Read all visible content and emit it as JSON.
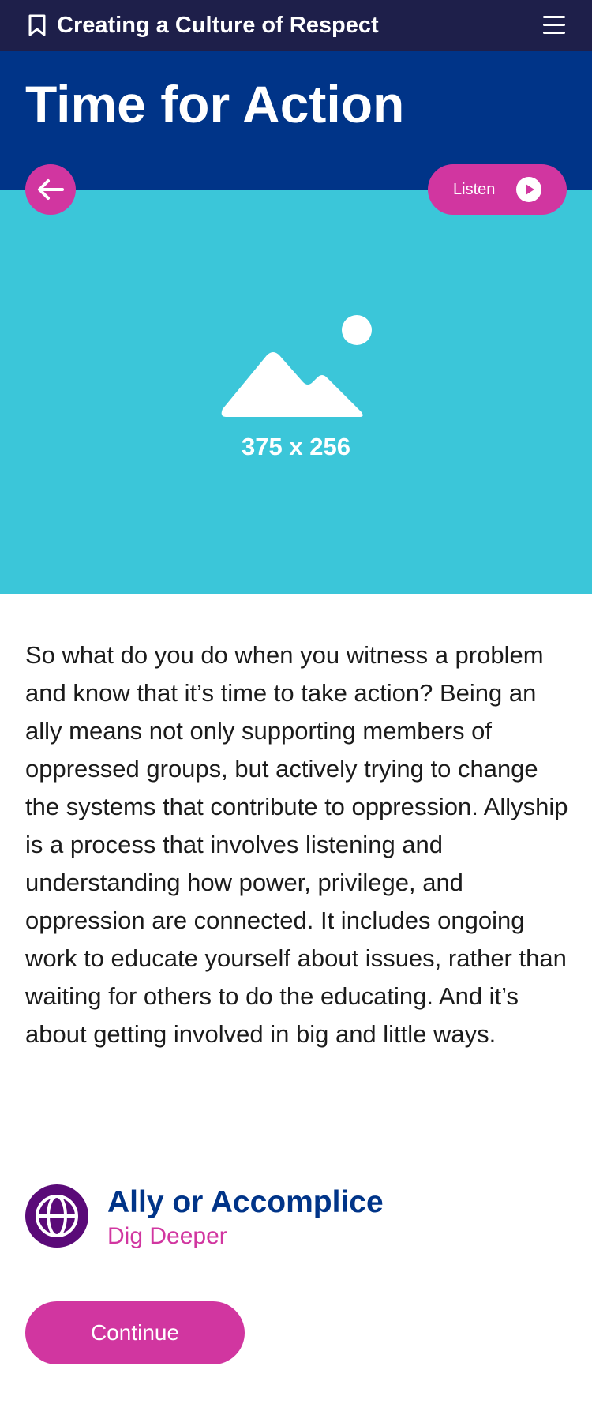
{
  "topbar": {
    "course_title": "Creating a Culture of Respect",
    "bookmark_icon": "bookmark-icon",
    "menu_icon": "hamburger-menu-icon"
  },
  "header": {
    "title": "Time for Action"
  },
  "hero": {
    "placeholder_label": "375 x 256",
    "icon": "image-placeholder-icon"
  },
  "controls": {
    "back_icon": "arrow-left-icon",
    "listen_label": "Listen",
    "play_icon": "play-icon"
  },
  "content": {
    "paragraph": "So what do you do when you witness a problem and know that it’s time to take action? Being an ally means not only supporting members of oppressed groups, but actively trying to change the systems that contribute to oppression. Allyship is a process that involves listening and understanding how power, privilege, and oppression are connected. It includes ongoing work to educate yourself about issues, rather than waiting for others to do the educating. And it’s about getting involved in big and little ways."
  },
  "resource": {
    "title": "Ally or Accomplice",
    "subtitle": "Dig Deeper",
    "icon": "globe-icon"
  },
  "footer": {
    "continue_label": "Continue"
  },
  "colors": {
    "topbar": "#1e1f4a",
    "header": "#003488",
    "hero": "#3bc6d9",
    "accent": "#d136a0",
    "globe": "#5a0a78"
  }
}
